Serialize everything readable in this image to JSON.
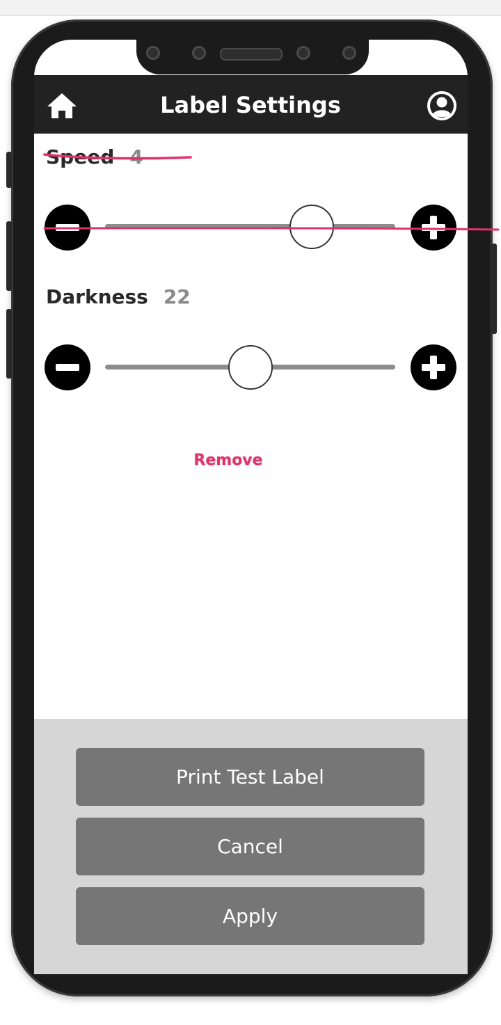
{
  "header": {
    "title": "Label Settings",
    "left_icon": "home-icon",
    "right_icon": "user-icon"
  },
  "settings": {
    "speed": {
      "label": "Speed",
      "value": "4",
      "slider_fraction": 0.75,
      "struck_through": true
    },
    "darkness": {
      "label": "Darkness",
      "value": "22",
      "slider_fraction": 0.5
    }
  },
  "annotation": {
    "remove_label": "Remove",
    "color": "#e0306e"
  },
  "actions": {
    "print_test_label": "Print Test Label",
    "cancel": "Cancel",
    "apply": "Apply"
  },
  "colors": {
    "header_bg": "#222222",
    "button_bg": "#767676",
    "panel_bg": "#d6d6d6",
    "track": "#8c8c8c"
  },
  "icons": {
    "decrease": "minus-circle-icon",
    "increase": "plus-circle-icon"
  }
}
